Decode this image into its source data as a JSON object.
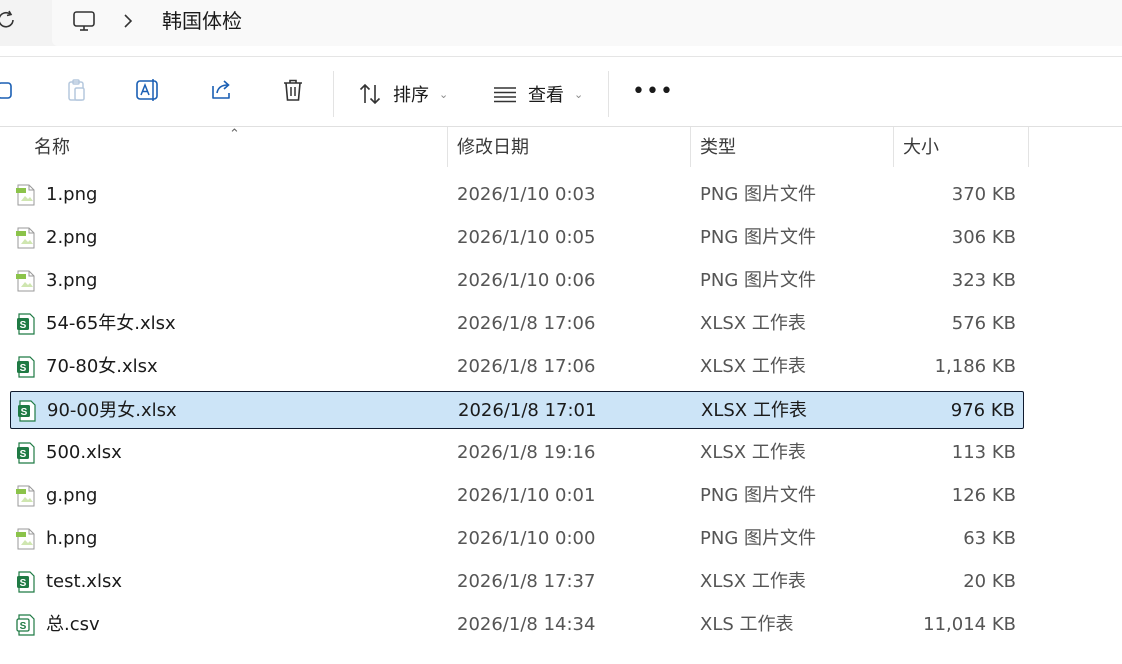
{
  "address": {
    "breadcrumb": "韩国体检"
  },
  "toolbar": {
    "sort_label": "排序",
    "view_label": "查看",
    "more_label": "•••"
  },
  "columns": {
    "name": "名称",
    "date": "修改日期",
    "type": "类型",
    "size": "大小"
  },
  "files": [
    {
      "name": "1.png",
      "date": "2026/1/10 0:03",
      "type": "PNG 图片文件",
      "size": "370 KB",
      "kind": "png-icon"
    },
    {
      "name": "2.png",
      "date": "2026/1/10 0:05",
      "type": "PNG 图片文件",
      "size": "306 KB",
      "kind": "png-icon"
    },
    {
      "name": "3.png",
      "date": "2026/1/10 0:06",
      "type": "PNG 图片文件",
      "size": "323 KB",
      "kind": "png-icon"
    },
    {
      "name": "54-65年女.xlsx",
      "date": "2026/1/8 17:06",
      "type": "XLSX 工作表",
      "size": "576 KB",
      "kind": "xlsx-icon"
    },
    {
      "name": "70-80女.xlsx",
      "date": "2026/1/8 17:06",
      "type": "XLSX 工作表",
      "size": "1,186 KB",
      "kind": "xlsx-icon"
    },
    {
      "name": "90-00男女.xlsx",
      "date": "2026/1/8 17:01",
      "type": "XLSX 工作表",
      "size": "976 KB",
      "kind": "xlsx-icon",
      "selected": true
    },
    {
      "name": "500.xlsx",
      "date": "2026/1/8 19:16",
      "type": "XLSX 工作表",
      "size": "113 KB",
      "kind": "xlsx-icon"
    },
    {
      "name": "g.png",
      "date": "2026/1/10 0:01",
      "type": "PNG 图片文件",
      "size": "126 KB",
      "kind": "png-icon"
    },
    {
      "name": "h.png",
      "date": "2026/1/10 0:00",
      "type": "PNG 图片文件",
      "size": "63 KB",
      "kind": "png-icon"
    },
    {
      "name": "test.xlsx",
      "date": "2026/1/8 17:37",
      "type": "XLSX 工作表",
      "size": "20 KB",
      "kind": "xlsx-icon"
    },
    {
      "name": "总.csv",
      "date": "2026/1/8 14:34",
      "type": "XLS 工作表",
      "size": "11,014 KB",
      "kind": "csv-icon"
    }
  ],
  "colors": {
    "selection_bg": "#cce4f7",
    "excel_green": "#1f7a44",
    "png_green": "#8bc34a"
  }
}
